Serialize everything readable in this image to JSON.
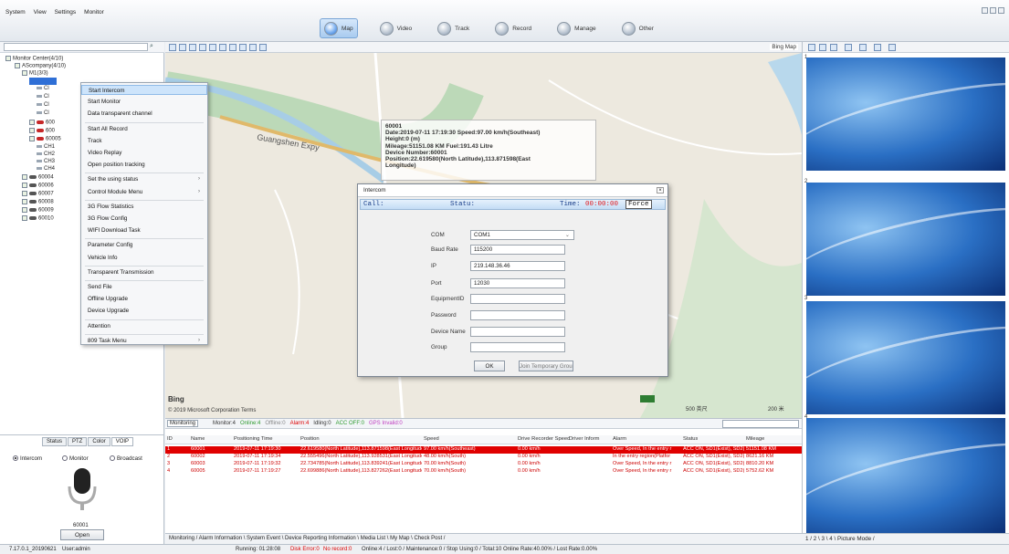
{
  "menu": [
    "System",
    "View",
    "Settings",
    "Monitor"
  ],
  "nav": [
    {
      "label": "Map",
      "active": true
    },
    {
      "label": "Video"
    },
    {
      "label": "Track"
    },
    {
      "label": "Record"
    },
    {
      "label": "Manage"
    },
    {
      "label": "Other"
    }
  ],
  "tree": {
    "root": "Monitor Center(4/10)",
    "company": "AScompany(4/10)",
    "group": "M1(3/3)",
    "v1": "600",
    "v2": "600",
    "v3": "60005",
    "channels": [
      "CH1",
      "CH2",
      "CH3",
      "CH4"
    ],
    "devices": [
      "60004",
      "60006",
      "60007",
      "60008",
      "60009",
      "60010"
    ],
    "ci": [
      "Cl",
      "Cl",
      "Cl",
      "Cl"
    ]
  },
  "context_menu": [
    {
      "label": "Start Intercom",
      "hl": true
    },
    {
      "label": "Start Monitor"
    },
    {
      "label": "Data transparent channel"
    },
    {
      "label": "Start All Record"
    },
    {
      "label": "Track"
    },
    {
      "label": "Video Replay"
    },
    {
      "label": "Open position tracking"
    },
    {
      "label": "Set the using status",
      "sub": true
    },
    {
      "label": "Control Module Menu",
      "sub": true
    },
    {
      "label": "3G Flow Statistics"
    },
    {
      "label": "3G Flow Config"
    },
    {
      "label": "WIFI Download Task"
    },
    {
      "label": "Parameter Config"
    },
    {
      "label": "Vehicle Info"
    },
    {
      "label": "Transparent Transmission"
    },
    {
      "label": "Send File"
    },
    {
      "label": "Offline Upgrade"
    },
    {
      "label": "Device Upgrade"
    },
    {
      "label": "Attention"
    },
    {
      "label": "809 Task Menu",
      "sub": true
    }
  ],
  "voip": {
    "tabs": [
      "Status",
      "PTZ",
      "Color",
      "VOIP"
    ],
    "modes": [
      "Intercom",
      "Monitor",
      "Broadcast"
    ],
    "device": "60001",
    "open_label": "Open"
  },
  "map": {
    "source": "Bing Map",
    "road": "Guangshen Expy",
    "bing": "Bing",
    "copyright": "© 2019 Microsoft Corporation Terms",
    "scale1": "500 英尺",
    "scale2": "200 米"
  },
  "info": {
    "line1": "60001",
    "line2": "Date:2019-07-11 17:19:30    Speed:97.00 km/h(Southeast)",
    "line3": "Height:0 (m)",
    "line4": "Mileage:51151.08 KM    Fuel:191.43 Litre",
    "line5": "Device Number:60001",
    "line6": "Position:22.619580(North Latitude),113.871598(East",
    "line7": "Longitude)"
  },
  "intercom": {
    "title": "Intercom",
    "call": "Call:",
    "status": "Statu:",
    "time_label": "Time:",
    "time": "00:00:00",
    "force": "Force",
    "com_label": "COM",
    "com": "COM1",
    "baud_label": "Baud Rate",
    "baud": "115200",
    "ip_label": "IP",
    "ip": "219.148.36.46",
    "port_label": "Port",
    "port": "12030",
    "equip_label": "EquipmentID",
    "equip": "",
    "pwd_label": "Password",
    "pwd": "",
    "devname_label": "Device Name",
    "devname": "",
    "group_label": "Group",
    "group": "",
    "ok": "OK",
    "temp": "Join Temporary Group"
  },
  "grid": {
    "monitoring": "Monitoring",
    "counts": [
      {
        "t": "Monitor:4",
        "c": "#333"
      },
      {
        "t": "Online:4",
        "c": "#2e9a2e"
      },
      {
        "t": "Offline:0",
        "c": "#888"
      },
      {
        "t": "Alarm:4",
        "c": "#d00"
      },
      {
        "t": "Idling:0",
        "c": "#333"
      },
      {
        "t": "ACC OFF:0",
        "c": "#2e9a2e"
      },
      {
        "t": "GPS Invalid:0",
        "c": "#c040c0"
      }
    ],
    "headers": [
      "ID",
      "Name",
      "Positioning Time",
      "Position",
      "Speed",
      "Drive Recorder Speed",
      "Driver Inform",
      "Alarm",
      "Status",
      "Mileage"
    ],
    "rows": [
      [
        "1",
        "60001",
        "2019-07-11 17:19:30",
        "22.619580(North Latitude),113.871598(East Longitude)",
        "97.00 km/h(Southeast)",
        "0.00 km/h",
        "",
        "Over Speed, In the entry r",
        "ACC ON, SD1(Exist), SD2(",
        "51151.08 KM"
      ],
      [
        "2",
        "60002",
        "2019-07-11 17:19:34",
        "22.555496(North Latitude),113.928531(East Longitude)",
        "48.00 km/h(South)",
        "0.00 km/h",
        "",
        "In the entry region(Platfor",
        "ACC ON, SD1(Exist), SD2(",
        "8621.16 KM"
      ],
      [
        "3",
        "60003",
        "2019-07-11 17:19:32",
        "22.734785(North Latitude),113.839241(East Longitude)",
        "70.00 km/h(South)",
        "0.00 km/h",
        "",
        "Over Speed, In the entry r",
        "ACC ON, SD1(Exist), SD2(",
        "8810.20 KM"
      ],
      [
        "4",
        "60005",
        "2019-07-11 17:19:27",
        "22.699886(North Latitude),113.827262(East Longitude)",
        "70.00 km/h(South)",
        "0.00 km/h",
        "",
        "Over Speed, In the entry r",
        "ACC ON, SD1(Exist), SD2(",
        "5752.62 KM"
      ]
    ]
  },
  "bottom_tabs": "Monitoring / Alarm Information \\ System Event \\ Device Reporting Information \\ Media List \\ My Map \\ Check Post /",
  "video": {
    "panels": [
      "1",
      "2",
      "3",
      "4"
    ],
    "tabs": "1 / 2 \\ 3 \\ 4 \\ Picture Mode /"
  },
  "status": {
    "version": "7.17.0.1_20190621",
    "user": "User:admin",
    "running": "Running: 01:28:08",
    "disk": "Disk Error:0",
    "norecord": "No record:0",
    "summary": "Online:4 / Lost:0 / Maintenance:0 / Stop Using:0 / Total:10  Online Rate:40.00% / Lost Rate:0.00%"
  }
}
